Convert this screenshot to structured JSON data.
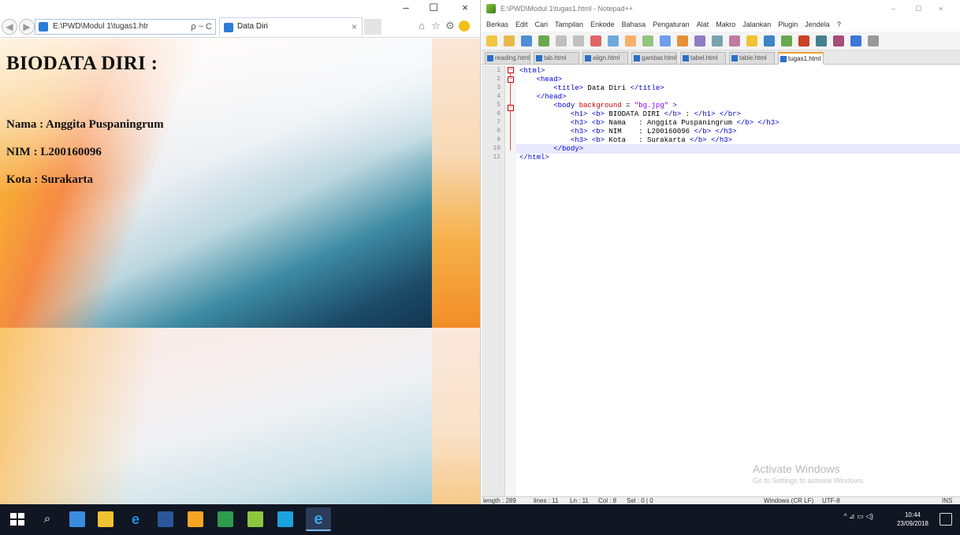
{
  "ie": {
    "address": "E:\\PWD\\Modul 1\\tugas1.htr",
    "address_tools": "ρ ~ C",
    "tab_title": "Data Diri",
    "tab_close": "×",
    "minimize": "–",
    "maximize": "☐",
    "close": "×"
  },
  "page": {
    "h1": "BIODATA DIRI :",
    "nama": "Nama : Anggita Puspaningrum",
    "nim": "NIM : L200160096",
    "kota": "Kota : Surakarta"
  },
  "npp": {
    "title": "E:\\PWD\\Modul 1\\tugas1.html - Notepad++",
    "menu": [
      "Berkas",
      "Edit",
      "Cari",
      "Tampilan",
      "Enkode",
      "Bahasa",
      "Pengaturan",
      "Alat",
      "Makro",
      "Jalankan",
      "Plugin",
      "Jendela",
      "?"
    ],
    "tabs": [
      "reading.html",
      "tab.html",
      "align.html",
      "gambar.html",
      "tabel.html",
      "table.html",
      "tugas1.html"
    ],
    "active_tab": "tugas1.html",
    "code": [
      {
        "n": "1",
        "parts": [
          [
            "tag",
            "<html>"
          ]
        ]
      },
      {
        "n": "2",
        "parts": [
          [
            "plain",
            "    "
          ],
          [
            "tag",
            "<head>"
          ]
        ]
      },
      {
        "n": "3",
        "parts": [
          [
            "plain",
            "        "
          ],
          [
            "tag",
            "<title>"
          ],
          [
            "plain",
            " Data Diri "
          ],
          [
            "tag",
            "</title>"
          ]
        ]
      },
      {
        "n": "4",
        "parts": [
          [
            "plain",
            "    "
          ],
          [
            "tag",
            "</head>"
          ]
        ]
      },
      {
        "n": "5",
        "parts": [
          [
            "plain",
            "        "
          ],
          [
            "tag",
            "<body "
          ],
          [
            "attr",
            "background"
          ],
          [
            "plain",
            " = "
          ],
          [
            "str",
            "\"bg.jpg\""
          ],
          [
            "tag",
            " >"
          ]
        ]
      },
      {
        "n": "6",
        "parts": [
          [
            "plain",
            "            "
          ],
          [
            "tag",
            "<h1>"
          ],
          [
            "plain",
            " "
          ],
          [
            "tag",
            "<b>"
          ],
          [
            "plain",
            " BIODATA DIRI "
          ],
          [
            "tag",
            "</b>"
          ],
          [
            "plain",
            " : "
          ],
          [
            "tag",
            "</h1>"
          ],
          [
            "plain",
            " "
          ],
          [
            "tag",
            "</br>"
          ]
        ]
      },
      {
        "n": "7",
        "parts": [
          [
            "plain",
            "            "
          ],
          [
            "tag",
            "<h3>"
          ],
          [
            "plain",
            " "
          ],
          [
            "tag",
            "<b>"
          ],
          [
            "plain",
            " Nama   : Anggita Puspaningrum "
          ],
          [
            "tag",
            "</b>"
          ],
          [
            "plain",
            " "
          ],
          [
            "tag",
            "</h3>"
          ]
        ]
      },
      {
        "n": "8",
        "parts": [
          [
            "plain",
            "            "
          ],
          [
            "tag",
            "<h3>"
          ],
          [
            "plain",
            " "
          ],
          [
            "tag",
            "<b>"
          ],
          [
            "plain",
            " NIM    : L200160096 "
          ],
          [
            "tag",
            "</b>"
          ],
          [
            "plain",
            " "
          ],
          [
            "tag",
            "</h3>"
          ]
        ]
      },
      {
        "n": "9",
        "parts": [
          [
            "plain",
            "            "
          ],
          [
            "tag",
            "<h3>"
          ],
          [
            "plain",
            " "
          ],
          [
            "tag",
            "<b>"
          ],
          [
            "plain",
            " Kota   : Surakarta "
          ],
          [
            "tag",
            "</b>"
          ],
          [
            "plain",
            " "
          ],
          [
            "tag",
            "</h3>"
          ]
        ]
      },
      {
        "n": "10",
        "parts": [
          [
            "plain",
            "        "
          ],
          [
            "tag",
            "</body>"
          ]
        ]
      },
      {
        "n": "11",
        "parts": [
          [
            "tag",
            "</html>"
          ]
        ]
      }
    ],
    "status": {
      "length": "length : 289",
      "lines": "lines : 11",
      "ln": "Ln : 11",
      "col": "Col : 8",
      "sel": "Sel : 0 | 0",
      "eol": "Windows (CR LF)",
      "enc": "UTF-8",
      "mode": "INS"
    }
  },
  "watermark": {
    "title": "Activate Windows",
    "sub": "Go to Settings to activate Windows."
  },
  "taskbar": {
    "time": "10:44",
    "date": "23/09/2018",
    "tray": "^ ⊿ ▭ ◁)"
  },
  "colors": {
    "tag": "#0000cc",
    "attr": "#cc0000",
    "string": "#8000ff",
    "taskbar": "#101622"
  }
}
